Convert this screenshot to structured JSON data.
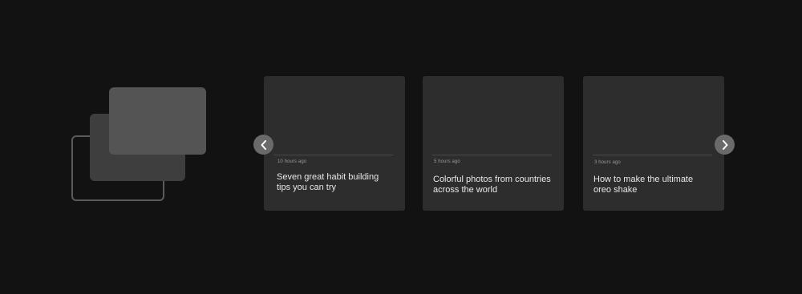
{
  "illustration": {
    "icon": "stacked-cards-icon"
  },
  "carousel": {
    "prev_icon": "chevron-left-icon",
    "next_icon": "chevron-right-icon",
    "cards": [
      {
        "time": "10 hours ago",
        "title": "Seven great habit building tips you can try"
      },
      {
        "time": "5 hours ago",
        "title": "Colorful photos from countries across the world"
      },
      {
        "time": "3 hours ago",
        "title": "How to make the ultimate  oreo shake"
      }
    ]
  },
  "colors": {
    "background": "#121212",
    "card": "#2d2d2d",
    "nav_button": "#6a6a6a",
    "text": "#e8e8e8"
  }
}
